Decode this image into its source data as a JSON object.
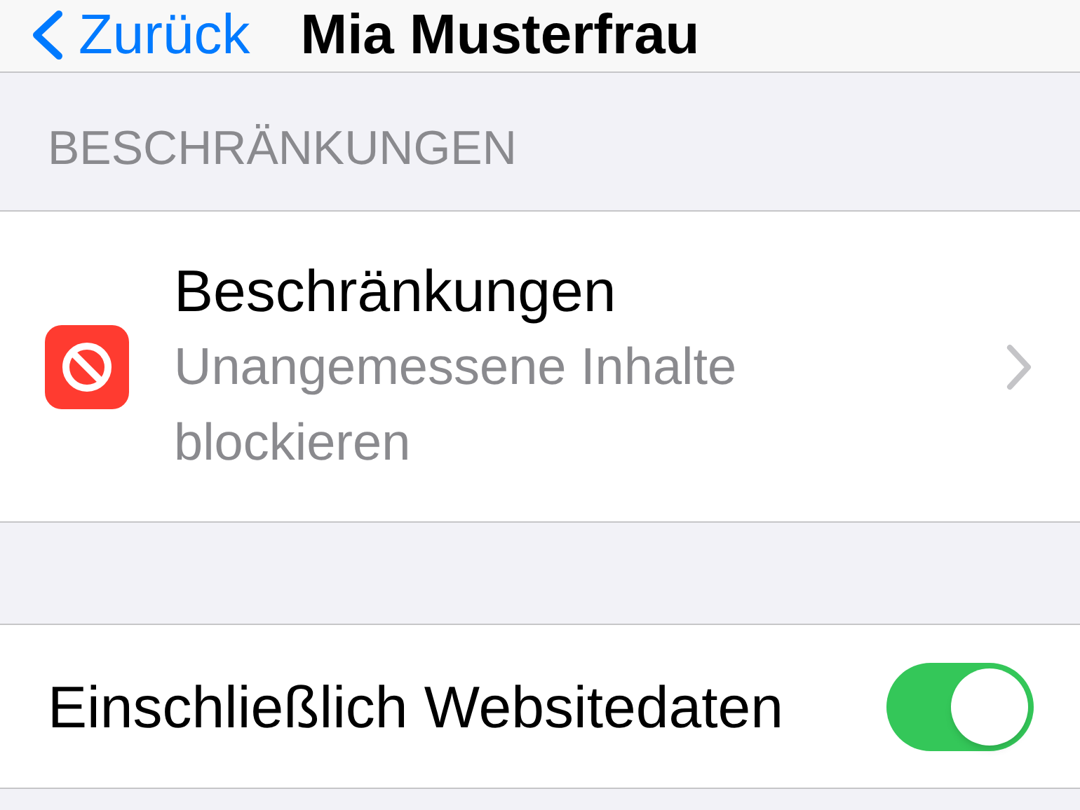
{
  "nav": {
    "back": "Zurück",
    "title": "Mia Musterfrau"
  },
  "section_header": "BESCHRÄNKUNGEN",
  "restrictions_cell": {
    "title": "Beschränkungen",
    "subtitle": "Unangemessene Inhalte blockieren"
  },
  "toggle_row": {
    "label": "Einschließlich Websitedaten",
    "on": true
  }
}
